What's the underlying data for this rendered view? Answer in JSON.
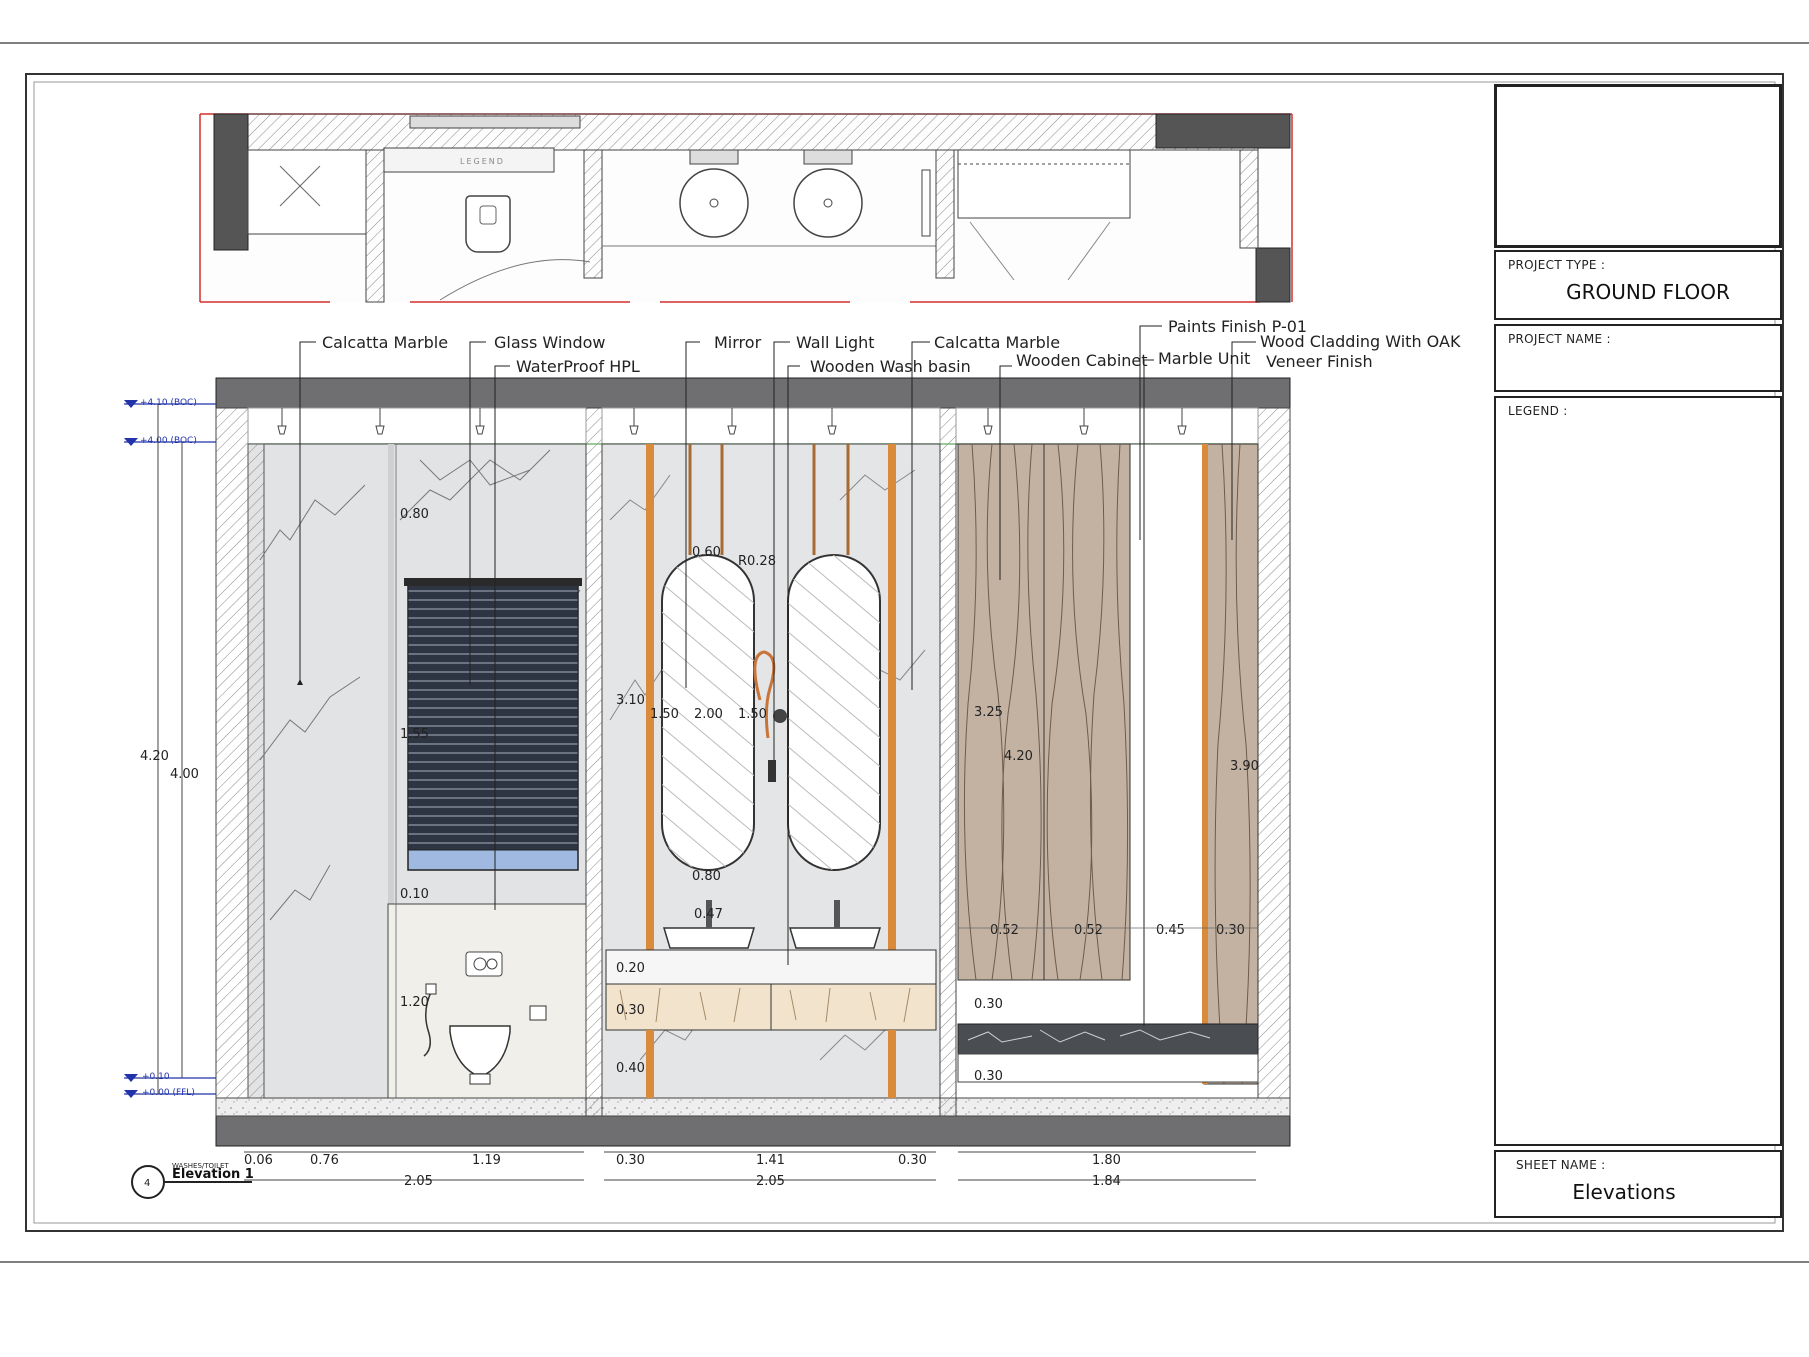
{
  "title_block": {
    "project_type_label": "PROJECT TYPE :",
    "project_type_value": "GROUND FLOOR",
    "project_name_label": "PROJECT NAME :",
    "project_name_value": "",
    "legend_label": "LEGEND :",
    "sheet_name_label": "SHEET NAME :",
    "sheet_name_value": "Elevations"
  },
  "drawing": {
    "tag_number": "4",
    "tag_subtitle": "WASHES/TOILET",
    "tag_title": "Elevation 1",
    "plan_text": "LEGEND",
    "levels": [
      "+4.10 (BOC)",
      "+4.00 (BOC)",
      "+0.10",
      "+0.00 (FFL)"
    ],
    "callouts": [
      "Calcatta Marble",
      "Glass Window",
      "WaterProof HPL",
      "Mirror",
      "Wall Light",
      "Wooden Wash basin",
      "Calcatta Marble",
      "Wooden Cabinet",
      "Paints Finish P-01",
      "Marble Unit",
      "Wood Cladding With OAK",
      "Veneer Finish"
    ],
    "overall_heights": [
      "4.20",
      "4.00"
    ],
    "section1_dims": [
      "0.80",
      "1.55",
      "0.10",
      "1.20"
    ],
    "section2_dims": [
      "0.60",
      "R0.28",
      "3.10",
      "1.50",
      "2.00",
      "1.50",
      "0.80",
      "0.47",
      "0.20",
      "0.30",
      "0.40"
    ],
    "section3_dims": [
      "3.25",
      "4.20",
      "3.90",
      "0.52",
      "0.52",
      "0.45",
      "0.30",
      "0.30",
      "0.30"
    ],
    "bottom_dims_row1": [
      "0.06",
      "0.76",
      "1.19",
      "0.30",
      "1.41",
      "0.30",
      "1.80"
    ],
    "bottom_dims_row2": [
      "2.05",
      "2.05",
      "1.84"
    ]
  },
  "colors": {
    "ink": "#222222",
    "slab": "#6f6f72",
    "marble": "#e2e3e5",
    "wood": "#c3b2a2",
    "blind": "#2e3542",
    "window_glass": "#9fb9e0",
    "accent_orange": "#d98a3a",
    "red_line": "#d32f2f",
    "level_blue": "#2233aa"
  }
}
